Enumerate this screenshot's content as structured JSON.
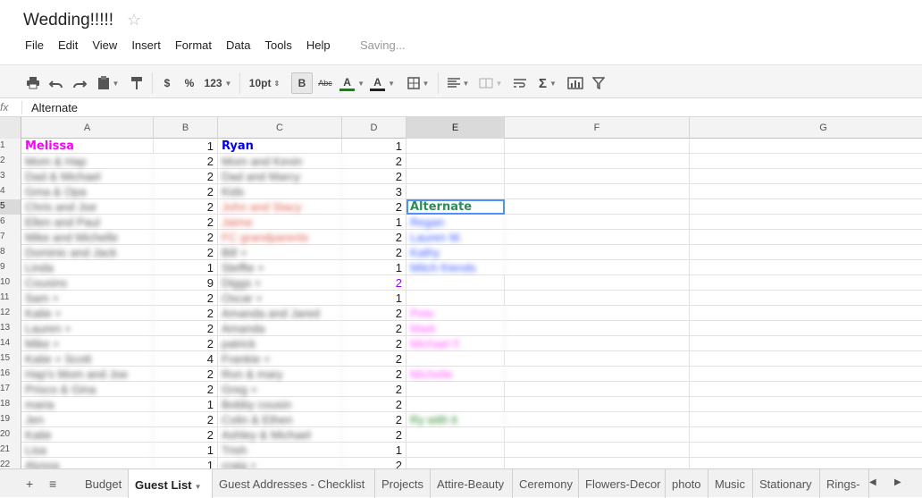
{
  "document": {
    "title": "Wedding!!!!!",
    "status": "Saving...",
    "star_icon": "star-icon"
  },
  "menu": [
    "File",
    "Edit",
    "View",
    "Insert",
    "Format",
    "Data",
    "Tools",
    "Help"
  ],
  "toolbar": {
    "currency": "$",
    "percent": "%",
    "number_format": "123",
    "font_size": "10pt",
    "bold": "B",
    "strike": "Abc",
    "text_color_label": "A",
    "fill_color_label": "A",
    "sum": "Σ",
    "text_color": "#0a8a0a",
    "fill_color": "#222222"
  },
  "formula_bar": {
    "fx": "fx",
    "value": "Alternate"
  },
  "columns": [
    "A",
    "B",
    "C",
    "D",
    "E",
    "F",
    "G"
  ],
  "selected_column": "E",
  "selected_row": 5,
  "rows": [
    {
      "n": "1",
      "a": "Melissa",
      "b": "1",
      "c": "Ryan",
      "d": "1",
      "e": ""
    },
    {
      "n": "2",
      "a": "Mom & Hap",
      "b": "2",
      "c": "Mom and Kevin",
      "d": "2",
      "e": ""
    },
    {
      "n": "3",
      "a": "Dad & Michael",
      "b": "2",
      "c": "Dad and Marcy",
      "d": "2",
      "e": ""
    },
    {
      "n": "4",
      "a": "Gma & Opa",
      "b": "2",
      "c": "Kids",
      "d": "3",
      "e": ""
    },
    {
      "n": "5",
      "a": "Chris and Joe",
      "b": "2",
      "c": "John and Stacy",
      "d": "2",
      "e": "Alternate"
    },
    {
      "n": "6",
      "a": "Ellen and Paul",
      "b": "2",
      "c": "Jaime",
      "d": "1",
      "e": "Regan"
    },
    {
      "n": "7",
      "a": "Mike and Michelle",
      "b": "2",
      "c": "FC grandparents",
      "d": "2",
      "e": "Lauren M."
    },
    {
      "n": "8",
      "a": "Dominic and Jack",
      "b": "2",
      "c": "Bill +",
      "d": "2",
      "e": "Kathy"
    },
    {
      "n": "9",
      "a": "Linda",
      "b": "1",
      "c": "Steffie +",
      "d": "1",
      "e": "Mitch friends"
    },
    {
      "n": "10",
      "a": "Cousins",
      "b": "9",
      "c": "Diggs +",
      "d": "2",
      "e": ""
    },
    {
      "n": "11",
      "a": "Sam +",
      "b": "2",
      "c": "Oscar +",
      "d": "1",
      "e": ""
    },
    {
      "n": "12",
      "a": "Katie +",
      "b": "2",
      "c": "Amanda and Jared",
      "d": "2",
      "e": "Pete"
    },
    {
      "n": "13",
      "a": "Lauren +",
      "b": "2",
      "c": "Amanda",
      "d": "2",
      "e": "Mark"
    },
    {
      "n": "14",
      "a": "Mike +",
      "b": "2",
      "c": "patrick",
      "d": "2",
      "e": "Michael F."
    },
    {
      "n": "15",
      "a": "Katie + Scott",
      "b": "4",
      "c": "Frankie +",
      "d": "2",
      "e": ""
    },
    {
      "n": "16",
      "a": "Hap's Mom and Joe",
      "b": "2",
      "c": "Ron & mary",
      "d": "2",
      "e": "Michelle"
    },
    {
      "n": "17",
      "a": "Prisco & Gina",
      "b": "2",
      "c": "Greg +",
      "d": "2",
      "e": ""
    },
    {
      "n": "18",
      "a": "maria",
      "b": "1",
      "c": "Bobby cousin",
      "d": "2",
      "e": ""
    },
    {
      "n": "19",
      "a": "Jen",
      "b": "2",
      "c": "Colin & Ethen",
      "d": "2",
      "e": "Ry with it"
    },
    {
      "n": "20",
      "a": "Katie",
      "b": "2",
      "c": "Ashley & Michael",
      "d": "2",
      "e": ""
    },
    {
      "n": "21",
      "a": "Lisa",
      "b": "1",
      "c": "Trish",
      "d": "1",
      "e": ""
    },
    {
      "n": "22",
      "a": "Alyssa",
      "b": "1",
      "c": "craig +",
      "d": "2",
      "e": ""
    }
  ],
  "colors": {
    "melissa": "#ff00ff",
    "ryan": "#0000ee",
    "alternate_header": "#2e8b57",
    "blue_names": "#3b5bff",
    "pink_names": "#ff55ff",
    "red_names": "#e06050",
    "purple_value": "#9900ff",
    "green_name": "#2e8b2e"
  },
  "sheet_tabs": [
    "Budget",
    "Guest List",
    "Guest Addresses - Checklist",
    "Projects",
    "Attire-Beauty",
    "Ceremony",
    "Flowers-Decor",
    "photo",
    "Music",
    "Stationary",
    "Rings-"
  ],
  "active_sheet": "Guest List",
  "sheet_icons": {
    "add": "+",
    "list": "≡"
  }
}
